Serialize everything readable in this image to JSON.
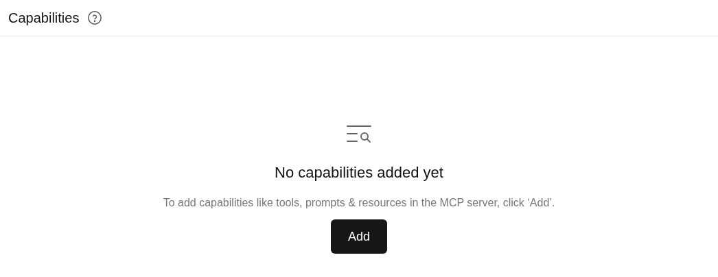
{
  "header": {
    "title": "Capabilities"
  },
  "empty_state": {
    "heading": "No capabilities added yet",
    "description": "To add capabilities like tools, prompts & resources in the MCP server, click ‘Add’.",
    "button": "Add"
  }
}
